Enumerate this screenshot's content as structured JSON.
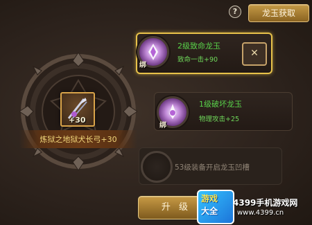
{
  "header": {
    "help_label": "?",
    "obtain_button": "龙玉获取"
  },
  "equipment": {
    "quantity": "+30",
    "name": "炼狱之地狱犬长弓+30"
  },
  "gem_slots": [
    {
      "bind_label": "绑",
      "title": "2级致命龙玉",
      "effect": "致命一击+90",
      "selected": true
    },
    {
      "bind_label": "绑",
      "title": "1级破坏龙玉",
      "effect": "物理攻击+25",
      "selected": false
    }
  ],
  "locked_slot": {
    "text": "53级装备开启龙玉凹槽"
  },
  "close_label": "✕",
  "upgrade_button": "升 级",
  "watermark": {
    "logo_line1": "游戏",
    "logo_line2": "大全",
    "site": "4399手机游戏网",
    "url": "www.4399.cn"
  },
  "colors": {
    "accent_gold": "#e8c24a",
    "gem_text_green": "#59d24a",
    "item_name_gold": "#f1d67a"
  }
}
